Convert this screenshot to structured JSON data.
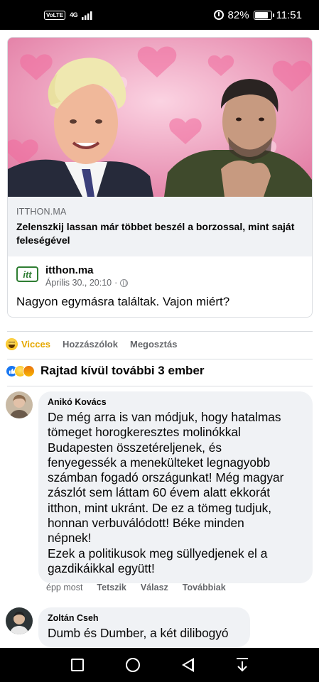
{
  "status_bar": {
    "volte": "VoLTE",
    "network": "4G",
    "battery": "82%",
    "battery_level": 0.82,
    "time": "11:51"
  },
  "shared_post": {
    "link_domain": "ITTHON.MA",
    "link_title": "Zelenszkij lassan már többet beszél a borzossal, mint saját feleségével",
    "page_logo": "itt",
    "page_name": "itthon.ma",
    "date": "Április 30., 20:10",
    "dot": "·",
    "text": "Nagyon egymásra találtak. Vajon miért?"
  },
  "actions": {
    "haha_label": "Vicces",
    "comment_label": "Hozzászólok",
    "share_label": "Megosztás"
  },
  "reactions": {
    "summary": "Rajtad kívül további 3 ember",
    "icons": [
      "like-icon",
      "haha-icon",
      "angry-icon"
    ]
  },
  "comments": [
    {
      "author": "Anikó Kovács",
      "text": "De még arra is van módjuk, hogy hatalmas\ntömeget horogkeresztes molinókkal\nBudapesten összetéreljenek, és\nfenyegessék a menekülteket legnagyobb\nszámban fogadó országunkat! Még magyar\nzászlót sem láttam 60 évem alatt ekkorát\nitthon, mint ukránt. De ez a tömeg tudjuk,\nhonnan verbuválódott! Béke minden\nnépnek!\nEzek a politikusok meg süllyedjenek el a\ngazdikáikkal együtt!",
      "time": "épp most",
      "like": "Tetszik",
      "reply": "Válasz",
      "more": "Továbbiak"
    },
    {
      "author": "Zoltán Cseh",
      "text": "Dumb és Dumber, a két dilibogyó"
    }
  ],
  "nav": {
    "icons": [
      "recent-apps-icon",
      "home-icon",
      "back-icon",
      "notification-pull-icon"
    ]
  }
}
